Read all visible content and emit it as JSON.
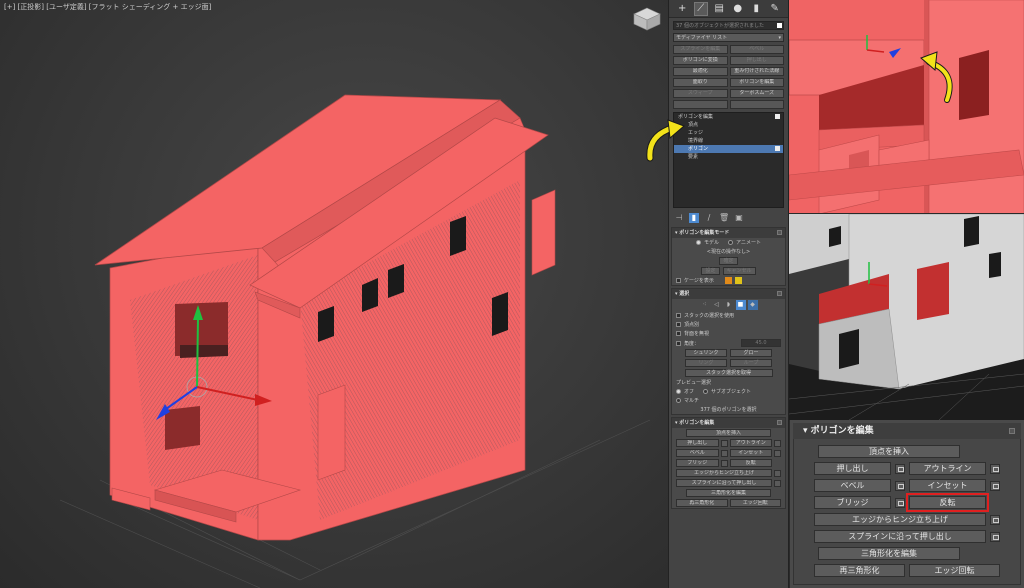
{
  "viewport": {
    "label": "[+] [正投影] [ユーザ定義] [フラット シェーディング + エッジ面]",
    "colors": {
      "mesh": "#f46464",
      "background": "#3b3b3b"
    }
  },
  "command_panel": {
    "tabs": [
      "+",
      "modify",
      "hierarchy",
      "motion",
      "display",
      "utilities"
    ],
    "selection_field": "37 個のオブジェクトが選択されました",
    "modifier_list": "モディファイヤ リスト",
    "modifier_buttons": [
      {
        "label": "スプラインを編集",
        "dim": true
      },
      {
        "label": "ベベル",
        "dim": true
      },
      {
        "label": "ポリゴンに変換",
        "dim": false
      },
      {
        "label": "押し出し",
        "dim": true
      },
      {
        "label": "最適化",
        "dim": false
      },
      {
        "label": "重み付けされた法線",
        "dim": false
      },
      {
        "label": "面取り",
        "dim": false
      },
      {
        "label": "ポリゴンを編集",
        "dim": false
      },
      {
        "label": "スウィープ",
        "dim": true
      },
      {
        "label": "ターボスムーズ",
        "dim": false
      },
      {
        "label": "",
        "dim": false
      },
      {
        "label": "",
        "dim": false
      }
    ],
    "stack": {
      "top": "ポリゴンを編集",
      "items": [
        "頂点",
        "エッジ",
        "境界線",
        "ポリゴン",
        "要素"
      ],
      "selected": "ポリゴン"
    },
    "edit_poly_mode": {
      "title": "ポリゴンを編集モード",
      "model": "モデル",
      "animate": "アニメート",
      "no_operation": "<現在の操作なし>",
      "commit": "確定",
      "settings": "設定",
      "cancel": "キャンセル",
      "show_cage": "ケージを表示"
    },
    "selection": {
      "title": "選択",
      "by_stack": "スタックの選択を使用",
      "by_vertex": "頂点別",
      "ignore_backfacing": "背面を無視",
      "by_angle": "角度：",
      "angle_value": "45.0",
      "shrink": "シュリンク",
      "grow": "グロー",
      "ring": "リング",
      "loop": "ループ",
      "get_stack": "スタック選択を取得",
      "preview_title": "プレビュー選択",
      "off": "オフ",
      "subobject": "サブオブジェクト",
      "multi": "マルチ",
      "status": "377 個のポリゴンを選択"
    },
    "edit_polygons": {
      "title": "ポリゴンを編集",
      "insert_vertex": "頂点を挿入",
      "extrude": "押し出し",
      "outline": "アウトライン",
      "bevel": "ベベル",
      "inset": "インセット",
      "bridge": "ブリッジ",
      "flip": "反転",
      "hinge": "エッジからヒンジ立ち上げ",
      "extrude_spline": "スプラインに沿って押し出し",
      "edit_tri": "三角形化を編集",
      "retriangulate": "再三角形化",
      "turn": "エッジ回転"
    }
  },
  "zoom_panel": {
    "title": "ポリゴンを編集",
    "insert_vertex": "頂点を挿入",
    "extrude": "押し出し",
    "outline": "アウトライン",
    "bevel": "ベベル",
    "inset": "インセット",
    "bridge": "ブリッジ",
    "flip": "反転",
    "hinge": "エッジからヒンジ立ち上げ",
    "extrude_spline": "スプラインに沿って押し出し",
    "edit_tri": "三角形化を編集",
    "retriangulate": "再三角形化",
    "turn": "エッジ回転",
    "highlight_color": "#e02020"
  },
  "annotations": {
    "arrow_color": "#f2e21a"
  }
}
